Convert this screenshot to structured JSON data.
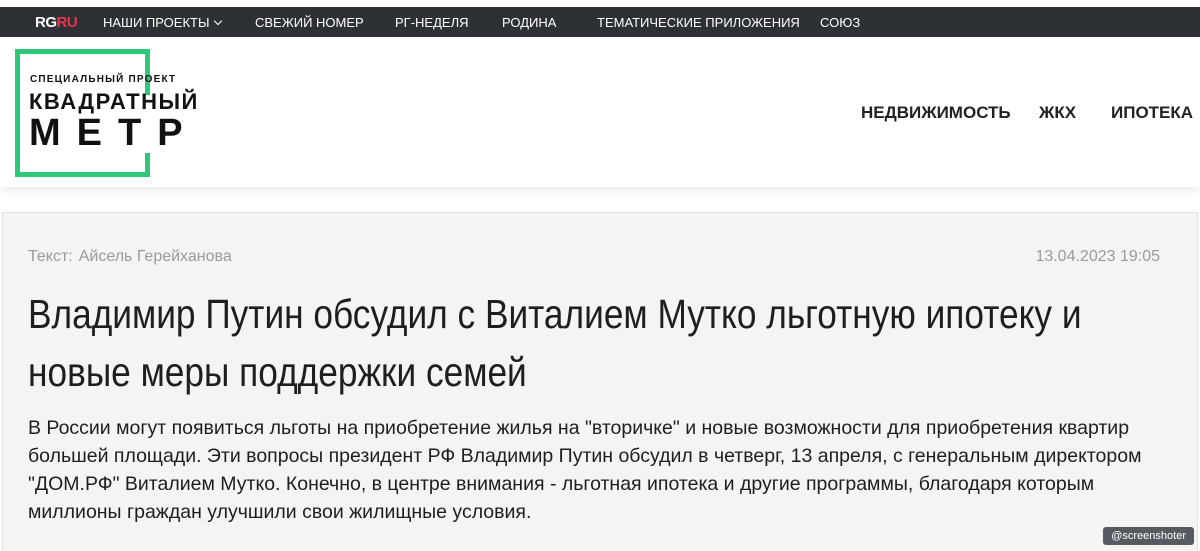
{
  "topbar": {
    "logo_rg": "RG",
    "logo_ru": "RU",
    "items": [
      {
        "label": "НАШИ ПРОЕКТЫ"
      },
      {
        "label": "СВЕЖИЙ НОМЕР"
      },
      {
        "label": "РГ-НЕДЕЛЯ"
      },
      {
        "label": "РОДИНА"
      },
      {
        "label": "ТЕМАТИЧЕСКИЕ ПРИЛОЖЕНИЯ"
      },
      {
        "label": "СОЮЗ"
      }
    ]
  },
  "logo": {
    "subtitle": "СПЕЦИАЛЬНЫЙ ПРОЕКТ",
    "line1": "КВАДРАТНЫЙ",
    "line2": "МЕТР",
    "accent_color": "#2fc77a"
  },
  "mainnav": {
    "items": [
      {
        "label": "НЕДВИЖИМОСТЬ"
      },
      {
        "label": "ЖКХ"
      },
      {
        "label": "ИПОТЕКА"
      }
    ]
  },
  "article": {
    "byline_label": "Текст:",
    "author": "Айсель Герейханова",
    "date": "13.04.2023 19:05",
    "title": "Владимир Путин обсудил с Виталием Мутко льготную ипотеку и новые меры поддержки семей",
    "lead": "В России могут появиться льготы на приобретение жилья на \"вторичке\" и новые возможности для приобретения квартир большей площади. Эти вопросы президент РФ Владимир Путин обсудил в четверг, 13 апреля, с генеральным директором \"ДОМ.РФ\" Виталием Мутко. Конечно, в центре внимания - льготная ипотека и другие программы, благодаря которым миллионы граждан улучшили свои жилищные условия."
  },
  "watermark": "@screenshoter"
}
